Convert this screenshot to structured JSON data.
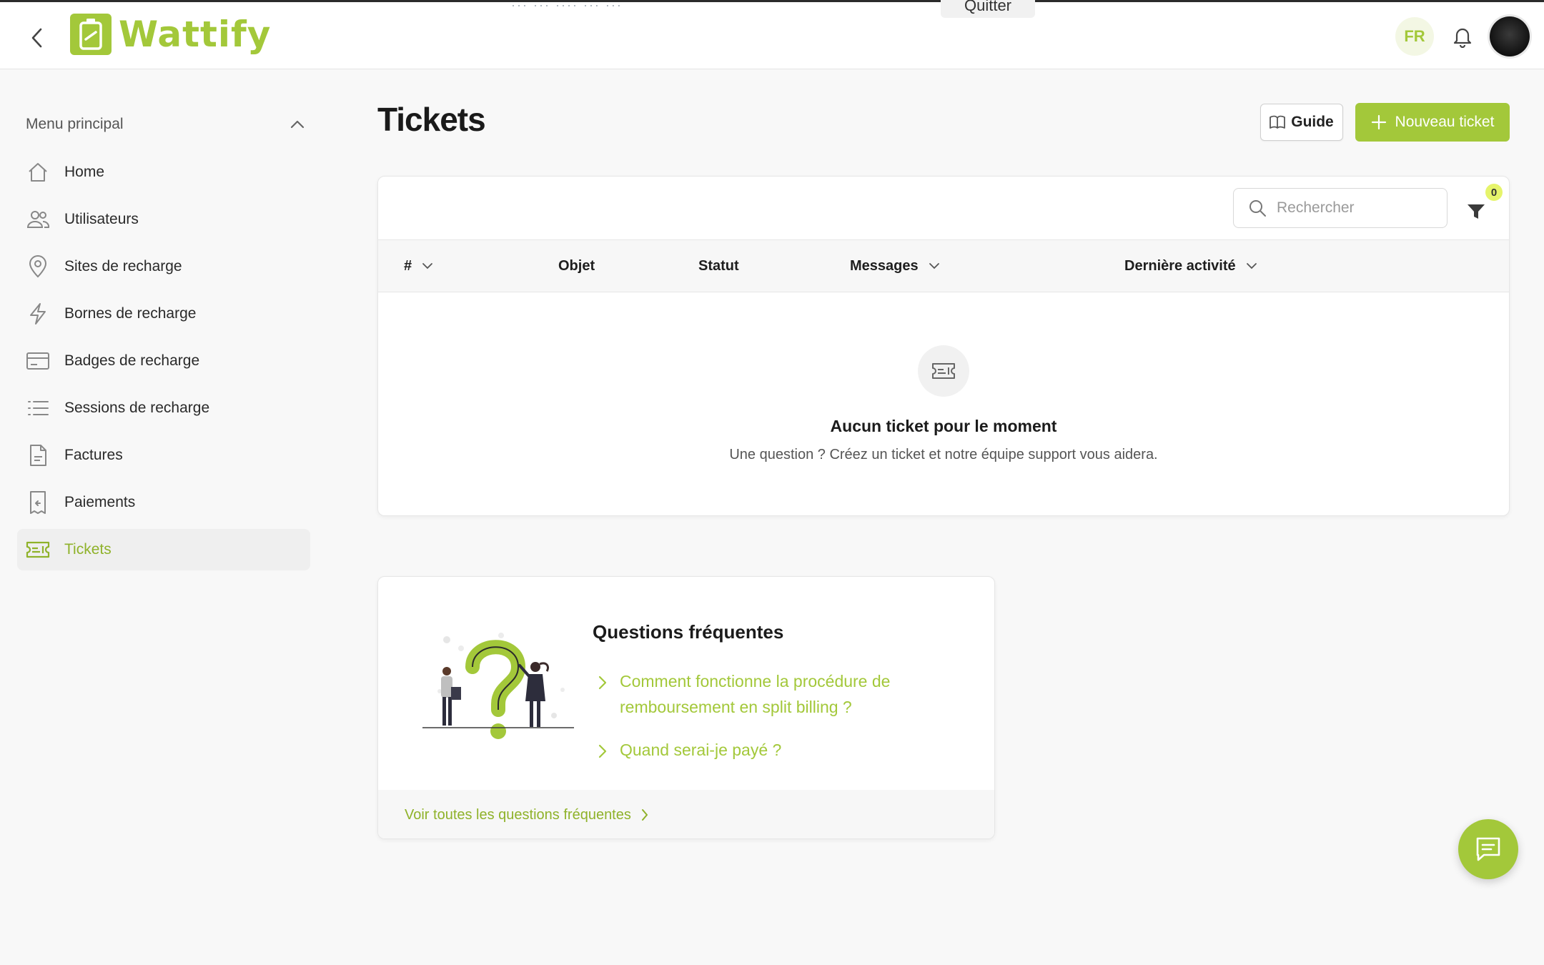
{
  "header": {
    "brand": "Wattify",
    "banner_stub": "··· ··· ···· ··· ···",
    "quit_label": "Quitter",
    "language": "FR"
  },
  "sidebar": {
    "section_title": "Menu principal",
    "items": [
      {
        "label": "Home",
        "icon": "home-icon"
      },
      {
        "label": "Utilisateurs",
        "icon": "users-icon"
      },
      {
        "label": "Sites de recharge",
        "icon": "map-pin-icon"
      },
      {
        "label": "Bornes de recharge",
        "icon": "bolt-icon"
      },
      {
        "label": "Badges de recharge",
        "icon": "card-icon"
      },
      {
        "label": "Sessions de recharge",
        "icon": "list-icon"
      },
      {
        "label": "Factures",
        "icon": "document-icon"
      },
      {
        "label": "Paiements",
        "icon": "receipt-icon"
      },
      {
        "label": "Tickets",
        "icon": "ticket-icon",
        "active": true
      }
    ]
  },
  "page": {
    "title": "Tickets",
    "guide_label": "Guide",
    "new_ticket_label": "Nouveau ticket"
  },
  "tickets": {
    "search_placeholder": "Rechercher",
    "filter_count": "0",
    "columns": [
      "#",
      "Objet",
      "Statut",
      "Messages",
      "Dernière activité"
    ],
    "empty_title": "Aucun ticket pour le moment",
    "empty_subtitle": "Une question ? Créez un ticket et notre équipe support vous aidera."
  },
  "faq": {
    "title": "Questions fréquentes",
    "items": [
      "Comment fonctionne la procédure de remboursement en split billing ?",
      "Quand serai-je payé ?"
    ],
    "see_all": "Voir toutes les questions fréquentes"
  },
  "colors": {
    "accent": "#a3c83a",
    "accent_dark": "#8fb22a",
    "badge": "#e6f46b"
  }
}
